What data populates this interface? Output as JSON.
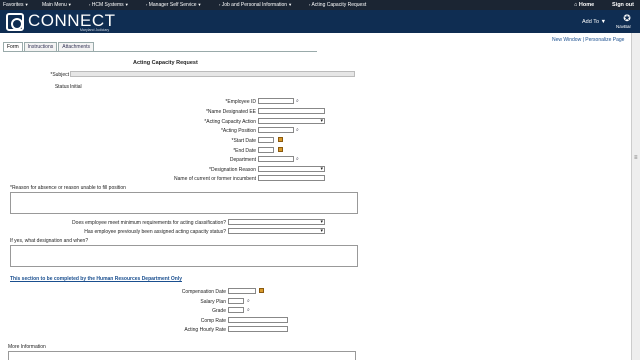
{
  "topbar": {
    "menus": [
      "Favorites",
      "Main Menu",
      "HCM Systems",
      "Manager Self Service",
      "Job and Personal Information"
    ],
    "breadcrumb_current": "Acting Capacity Request",
    "home": "Home",
    "signout": "Sign out"
  },
  "banner": {
    "logo": "CONNECT",
    "logo_sub": "Maryland Judiciary",
    "add_to": "Add To",
    "navbar": "NavBar"
  },
  "tabs": [
    "Form",
    "Instructions",
    "Attachments"
  ],
  "links": {
    "new_window": "New Window",
    "separator": " | ",
    "personalize": "Personalize Page"
  },
  "form": {
    "title": "Acting Capacity Request",
    "subject_label": "*Subject",
    "status_label": "Status",
    "status_value": "Initial",
    "employee_id": "*Employee ID",
    "name_designated": "*Name Designated EE",
    "acting_action": "*Acting Capacity Action",
    "acting_position": "*Acting Position",
    "start_date": "*Start Date",
    "end_date": "*End Date",
    "department": "Department",
    "designation_reason": "*Designation Reason",
    "incumbent": "Name of current or former incumbent",
    "reason_absence": "*Reason for absence or reason unable to fill position",
    "meet_requirements": "Does employee meet minimum requirements for acting classification?",
    "previously_assigned": "Has employee previously been assigned acting capacity status?",
    "if_yes": "If yes, what designation and when?",
    "hr_section": "This section to be completed by the Human Resources Department Only",
    "comp_date": "Compensation Date",
    "salary_plan": "Salary Plan",
    "grade": "Grade",
    "comp_rate": "Comp Rate",
    "acting_hourly": "Acting Hourly Rate",
    "more_info": "More Information"
  },
  "icons": {
    "search": "magnifier-icon",
    "calendar": "calendar-icon",
    "dropdown": "chevron-down-icon"
  }
}
